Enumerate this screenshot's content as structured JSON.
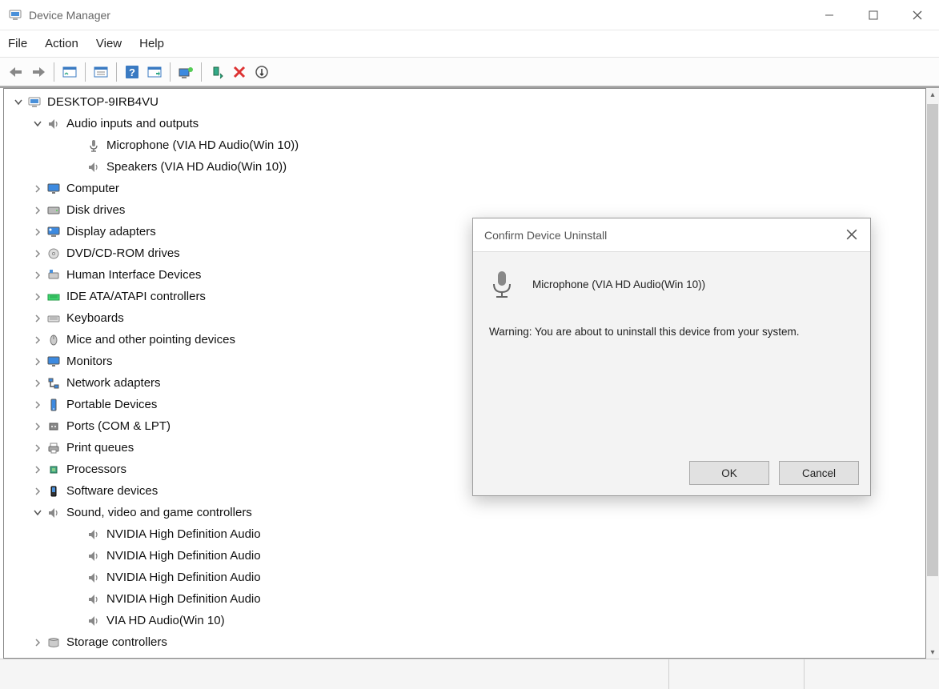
{
  "window_title": "Device Manager",
  "menu": [
    "File",
    "Action",
    "View",
    "Help"
  ],
  "tree_root": "DESKTOP-9IRB4VU",
  "tree": [
    {
      "label": "Audio inputs and outputs",
      "icon": "speaker",
      "expanded": true,
      "children": [
        {
          "label": "Microphone (VIA HD Audio(Win 10))",
          "icon": "mic"
        },
        {
          "label": "Speakers (VIA HD Audio(Win 10))",
          "icon": "speaker"
        }
      ]
    },
    {
      "label": "Computer",
      "icon": "monitor",
      "expanded": false
    },
    {
      "label": "Disk drives",
      "icon": "disk",
      "expanded": false
    },
    {
      "label": "Display adapters",
      "icon": "display",
      "expanded": false
    },
    {
      "label": "DVD/CD-ROM drives",
      "icon": "dvd",
      "expanded": false
    },
    {
      "label": "Human Interface Devices",
      "icon": "hid",
      "expanded": false
    },
    {
      "label": "IDE ATA/ATAPI controllers",
      "icon": "ide",
      "expanded": false
    },
    {
      "label": "Keyboards",
      "icon": "keyboard",
      "expanded": false
    },
    {
      "label": "Mice and other pointing devices",
      "icon": "mouse",
      "expanded": false
    },
    {
      "label": "Monitors",
      "icon": "monitor",
      "expanded": false
    },
    {
      "label": "Network adapters",
      "icon": "network",
      "expanded": false
    },
    {
      "label": "Portable Devices",
      "icon": "portable",
      "expanded": false
    },
    {
      "label": "Ports (COM & LPT)",
      "icon": "ports",
      "expanded": false
    },
    {
      "label": "Print queues",
      "icon": "printer",
      "expanded": false
    },
    {
      "label": "Processors",
      "icon": "cpu",
      "expanded": false
    },
    {
      "label": "Software devices",
      "icon": "software",
      "expanded": false
    },
    {
      "label": "Sound, video and game controllers",
      "icon": "speaker",
      "expanded": true,
      "children": [
        {
          "label": "NVIDIA High Definition Audio",
          "icon": "speaker"
        },
        {
          "label": "NVIDIA High Definition Audio",
          "icon": "speaker"
        },
        {
          "label": "NVIDIA High Definition Audio",
          "icon": "speaker"
        },
        {
          "label": "NVIDIA High Definition Audio",
          "icon": "speaker"
        },
        {
          "label": "VIA HD Audio(Win 10)",
          "icon": "speaker"
        }
      ]
    },
    {
      "label": "Storage controllers",
      "icon": "storage",
      "expanded": false
    }
  ],
  "dialog": {
    "title": "Confirm Device Uninstall",
    "device": "Microphone (VIA HD Audio(Win 10))",
    "warning": "Warning: You are about to uninstall this device from your system.",
    "ok": "OK",
    "cancel": "Cancel"
  }
}
